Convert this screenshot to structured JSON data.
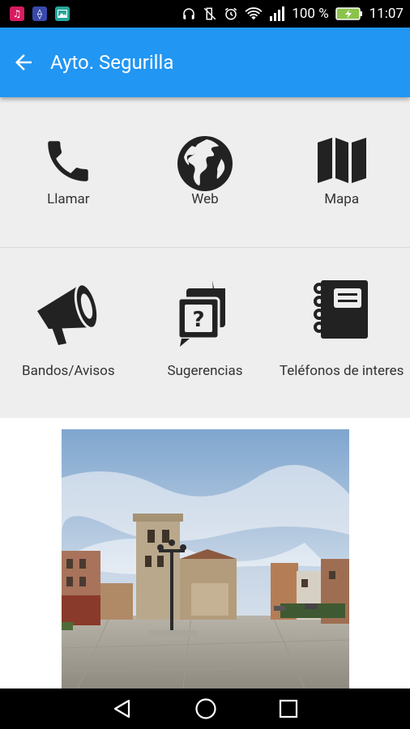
{
  "status_bar": {
    "battery": "100 %",
    "time": "11:07",
    "app_icons": [
      "music-app-icon",
      "usb-app-icon",
      "gallery-app-icon"
    ]
  },
  "app_bar": {
    "title": "Ayto. Segurilla",
    "color": "#2196f3"
  },
  "menu": {
    "items": [
      {
        "label": "Llamar",
        "icon": "phone-icon"
      },
      {
        "label": "Web",
        "icon": "globe-icon"
      },
      {
        "label": "Mapa",
        "icon": "map-icon"
      },
      {
        "label": "Bandos/Avisos",
        "icon": "megaphone-icon"
      },
      {
        "label": "Sugerencias",
        "icon": "suggestions-icon"
      },
      {
        "label": "Teléfonos de interes",
        "icon": "phonebook-icon"
      }
    ]
  },
  "navigation": [
    "back-icon",
    "home-icon",
    "recents-icon"
  ]
}
